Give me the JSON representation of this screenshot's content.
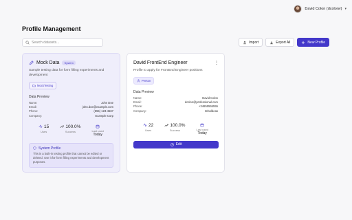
{
  "header": {
    "user_name": "David Colon (dcolonv)",
    "avatar_icon": "avatar",
    "chevron_icon": "chevron-down-icon"
  },
  "page": {
    "title": "Profile Management"
  },
  "search": {
    "placeholder": "Search datasets...",
    "value": ""
  },
  "actions": {
    "import_label": "Import",
    "export_label": "Export All",
    "new_label": "New Profile"
  },
  "colors": {
    "accent": "#4338ca",
    "system_card_bg": "#efeefb"
  },
  "cards": [
    {
      "title": "Mock Data",
      "badge": "System",
      "description": "Sample testing data for form filling experiments and development",
      "tag": "MockTesting",
      "section_label": "Data Preview",
      "fields": [
        {
          "k": "Name:",
          "v": "John Doe"
        },
        {
          "k": "Email:",
          "v": "john.doe@example.com"
        },
        {
          "k": "Phone:",
          "v": "(555) 123-4567"
        },
        {
          "k": "Company:",
          "v": "Example Corp"
        }
      ],
      "stats": {
        "uses_value": "15",
        "uses_label": "Uses",
        "success_value": "100.0%",
        "success_label": "Success",
        "last_used_label": "Last used",
        "last_used_value": "Today"
      },
      "system_box": {
        "title": "System Profile",
        "text": "This is a built-in testing profile that cannot be edited or deleted. Use it for form filling experiments and development purposes."
      }
    },
    {
      "title": "David FrontEnd Engineer",
      "description": "Profile to apply for FrontEnd Engineer positions",
      "tag": "Person",
      "section_label": "Data Preview",
      "fields": [
        {
          "k": "Name:",
          "v": "David Colon"
        },
        {
          "k": "Email:",
          "v": "dcolon@professional.com"
        },
        {
          "k": "Phone:",
          "v": "+34655555555"
        },
        {
          "k": "Company:",
          "v": "Imboldeas"
        }
      ],
      "stats": {
        "uses_value": "22",
        "uses_label": "Uses",
        "success_value": "100.0%",
        "success_label": "Success",
        "last_used_label": "Last used",
        "last_used_value": "Today"
      },
      "edit_label": "Edit"
    }
  ]
}
